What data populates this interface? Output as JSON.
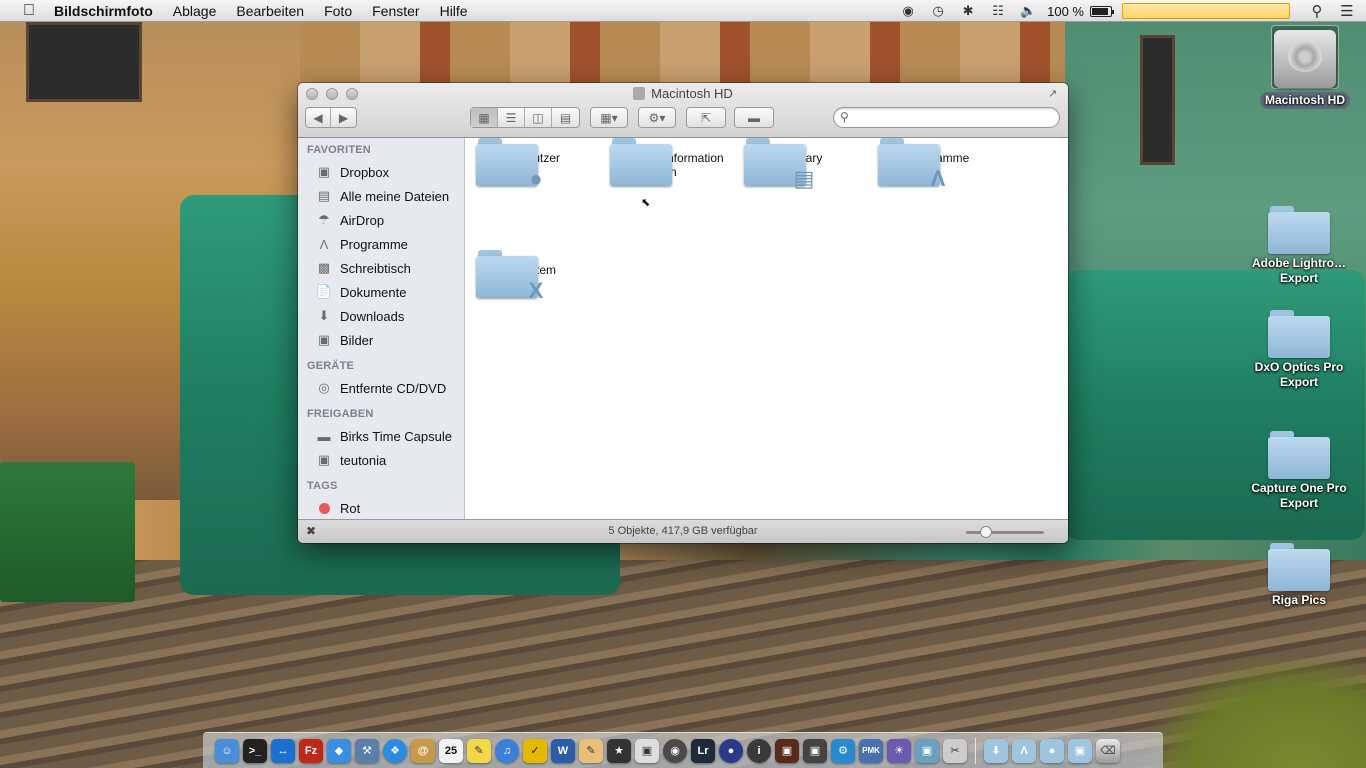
{
  "menubar": {
    "app_name": "Bildschirmfoto",
    "menus": [
      "Ablage",
      "Bearbeiten",
      "Foto",
      "Fenster",
      "Hilfe"
    ],
    "battery_text": "100 %"
  },
  "desktop": {
    "icons": [
      {
        "label": "Macintosh HD"
      },
      {
        "label": "Adobe Lightro…Export"
      },
      {
        "label": "DxO Optics Pro Export"
      },
      {
        "label": "Capture One Pro Export"
      },
      {
        "label": "Riga Pics"
      }
    ]
  },
  "finder": {
    "title": "Macintosh HD",
    "sidebar": {
      "favorites_header": "FAVORITEN",
      "favorites": [
        {
          "label": "Dropbox",
          "icon": "dropbox-icon"
        },
        {
          "label": "Alle meine Dateien",
          "icon": "all-files-icon"
        },
        {
          "label": "AirDrop",
          "icon": "airdrop-icon"
        },
        {
          "label": "Programme",
          "icon": "applications-icon"
        },
        {
          "label": "Schreibtisch",
          "icon": "desktop-icon"
        },
        {
          "label": "Dokumente",
          "icon": "documents-icon"
        },
        {
          "label": "Downloads",
          "icon": "downloads-icon"
        },
        {
          "label": "Bilder",
          "icon": "pictures-icon"
        }
      ],
      "devices_header": "GERÄTE",
      "devices": [
        {
          "label": "Entfernte CD/DVD",
          "icon": "remote-disc-icon"
        }
      ],
      "shared_header": "FREIGABEN",
      "shared": [
        {
          "label": "Birks Time Capsule",
          "icon": "time-capsule-icon"
        },
        {
          "label": "teutonia",
          "icon": "computer-icon"
        }
      ],
      "tags_header": "TAGS",
      "tags": [
        {
          "label": "Rot",
          "color": "#e9595a"
        }
      ]
    },
    "items": [
      {
        "label": "Benutzer",
        "glyph": "user-glyph-icon"
      },
      {
        "label": "Benutzerinformationen",
        "glyph": "alias-icon"
      },
      {
        "label": "Library",
        "glyph": "library-glyph-icon"
      },
      {
        "label": "Programme",
        "glyph": "applications-glyph-icon"
      },
      {
        "label": "System",
        "glyph": "system-glyph-icon"
      }
    ],
    "status": "5 Objekte, 417,9 GB verfügbar"
  },
  "dock": {
    "apps": [
      "Finder",
      "Terminal",
      "TeamViewer",
      "FileZilla",
      "Dropbox",
      "Xcode",
      "Safari",
      "Contacts",
      "Calendar",
      "Stickies",
      "iTunes",
      "Ontrack",
      "Word",
      "Notes",
      "Pixelmator",
      "Preview",
      "Aperture",
      "Lightroom",
      "Photo",
      "Capture",
      "Photo Booth",
      "Finder Alt",
      "Preferences",
      "PMK",
      "Sky",
      "Image",
      "Tool"
    ],
    "folders": [
      "Downloads",
      "Programme",
      "Dokumente",
      "Applications"
    ],
    "trash": "Trash"
  }
}
